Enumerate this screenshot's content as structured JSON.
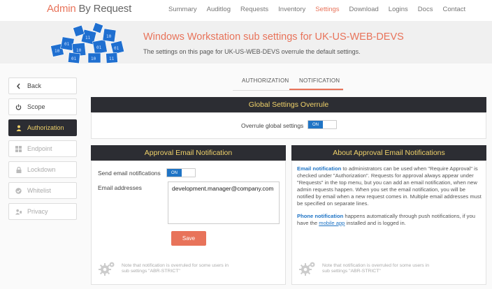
{
  "app": {
    "logo_part1": "Admin",
    "logo_part2": " By Request"
  },
  "nav": {
    "items": [
      "Summary",
      "Auditlog",
      "Requests",
      "Inventory",
      "Settings",
      "Download",
      "Logins",
      "Docs",
      "Contact"
    ],
    "active": "Settings"
  },
  "header": {
    "title": "Windows Workstation sub settings for UK-US-WEB-DEVS",
    "subtitle": "The settings on this page for UK-US-WEB-DEVS overrule the default settings."
  },
  "sidebar": {
    "items": [
      {
        "label": "Back",
        "icon": "chevron-left-icon",
        "state": "normal"
      },
      {
        "label": "Scope",
        "icon": "power-icon",
        "state": "normal"
      },
      {
        "label": "Authorization",
        "icon": "user-icon",
        "state": "active"
      },
      {
        "label": "Endpoint",
        "icon": "windows-icon",
        "state": "disabled"
      },
      {
        "label": "Lockdown",
        "icon": "lock-icon",
        "state": "disabled"
      },
      {
        "label": "Whitelist",
        "icon": "check-circle-icon",
        "state": "disabled"
      },
      {
        "label": "Privacy",
        "icon": "user-secret-icon",
        "state": "disabled"
      }
    ]
  },
  "tabs": {
    "authorization": "AUTHORIZATION",
    "notification": "NOTIFICATION",
    "active": "NOTIFICATION"
  },
  "global": {
    "title": "Global Settings Overrule",
    "overrule_label": "Overrule global settings",
    "overrule_toggle": "ON"
  },
  "approval": {
    "title": "Approval Email Notification",
    "send_label": "Send email notifications",
    "send_toggle": "ON",
    "email_label": "Email addresses",
    "email_value": "development.manager@company.com",
    "save_label": "Save",
    "note": "Note that notification is overruled for some users in sub settings \"ABR-STRICT\""
  },
  "about": {
    "title": "About Approval Email Notifications",
    "p1_link": "Email notification",
    "p1_text": " to administrators can be used when \"Require Approval\" is checked under \"Authorization\". Requests for approval always appear under \"Requests\" in the top menu, but you can add an email notification, when new admin requests happen. When you set the email notification, you will be notified by email when a new request comes in. Multiple email addresses must be specified on separate lines.",
    "p2_link": "Phone notification",
    "p2_text_a": " happens automatically through push notifications, if you have the ",
    "p2_mobile_link": "mobile app",
    "p2_text_b": " installed and is logged in.",
    "note": "Note that notification is overruled for some users in sub settings \"ABR-STRICT\""
  },
  "colors": {
    "accent": "#e8735a",
    "dark": "#2c2d33",
    "yellow": "#f0d26a",
    "blue": "#1f74c5"
  }
}
